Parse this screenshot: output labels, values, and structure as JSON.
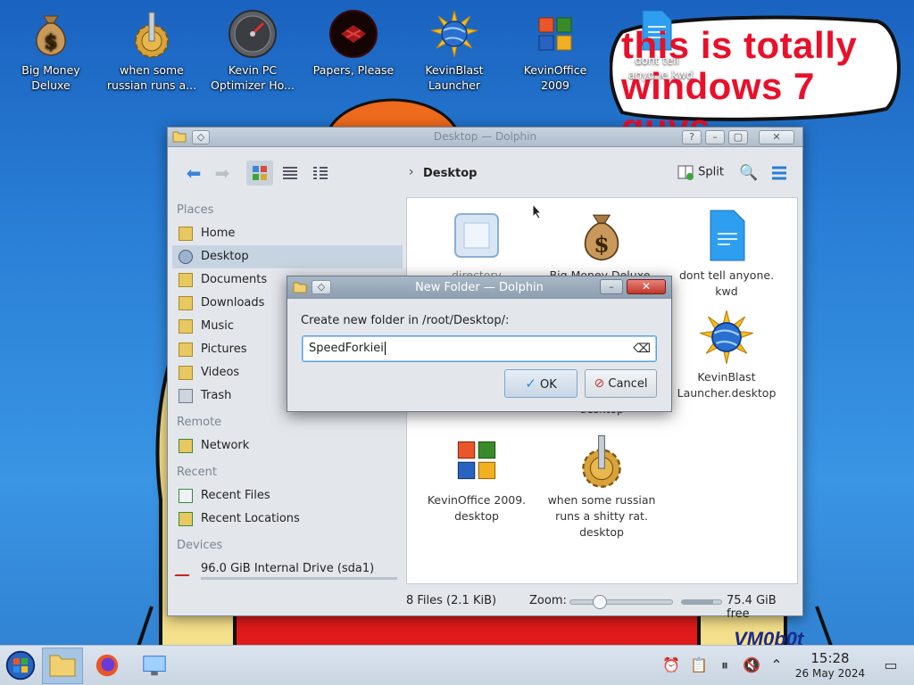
{
  "desktop": {
    "icons": [
      {
        "label": "Big Money\nDeluxe",
        "icon": "money-bag-icon"
      },
      {
        "label": "when some\nrussian runs a...",
        "icon": "gear-icon"
      },
      {
        "label": "Kevin PC\nOptimizer Ho...",
        "icon": "speedometer-icon"
      },
      {
        "label": "Papers, Please",
        "icon": "papers-please-icon"
      },
      {
        "label": "KevinBlast\nLauncher",
        "icon": "globe-burst-icon"
      },
      {
        "label": "KevinOffice\n2009",
        "icon": "office-logo-icon"
      }
    ],
    "bubble_file": {
      "label": "dont tell\nanyone.kwd",
      "icon": "document-icon"
    },
    "bubble_text": "this is totally windows 7 guys",
    "watermark": "VM0b0t"
  },
  "dolphin": {
    "title": "Desktop — Dolphin",
    "breadcrumb": "Desktop",
    "split_label": "Split",
    "places_header": "Places",
    "places": [
      "Home",
      "Desktop",
      "Documents",
      "Downloads",
      "Music",
      "Pictures",
      "Videos",
      "Trash"
    ],
    "remote_header": "Remote",
    "remote": [
      "Network"
    ],
    "recent_header": "Recent",
    "recent": [
      "Recent Files",
      "Recent Locations"
    ],
    "devices_header": "Devices",
    "devices": [
      "96.0 GiB Internal Drive (sda1)"
    ],
    "files": [
      {
        "name": "directory",
        "icon": "directory-icon"
      },
      {
        "name": "Big Money Deluxe.\ndesktop",
        "icon": "money-bag-icon"
      },
      {
        "name": "dont tell anyone.\nkwd",
        "icon": "document-icon"
      },
      {
        "name": "",
        "icon": ""
      },
      {
        "name": "desktop",
        "icon": ""
      },
      {
        "name": "KevinBlast\nLauncher.desktop",
        "icon": "globe-burst-icon"
      },
      {
        "name": "KevinOffice 2009.\ndesktop",
        "icon": "office-logo-icon"
      },
      {
        "name": "when some russian\nruns a shitty rat.\ndesktop",
        "icon": "gear-icon"
      }
    ],
    "status_text": "8 Files (2.1 KiB)",
    "zoom_label": "Zoom:",
    "free_space": "75.4 GiB free",
    "zoom_level": 0.22,
    "free_fraction": 0.2
  },
  "dialog": {
    "title": "New Folder — Dolphin",
    "label": "Create new folder in /root/Desktop/:",
    "input_value": "SpeedForkiei",
    "ok_label": "OK",
    "cancel_label": "Cancel"
  },
  "taskbar": {
    "time": "15:28",
    "date": "26 May 2024"
  },
  "colors": {
    "accent": "#3d8ee0",
    "selection": "#c6d4e2",
    "bubble_text": "#e8102a"
  }
}
